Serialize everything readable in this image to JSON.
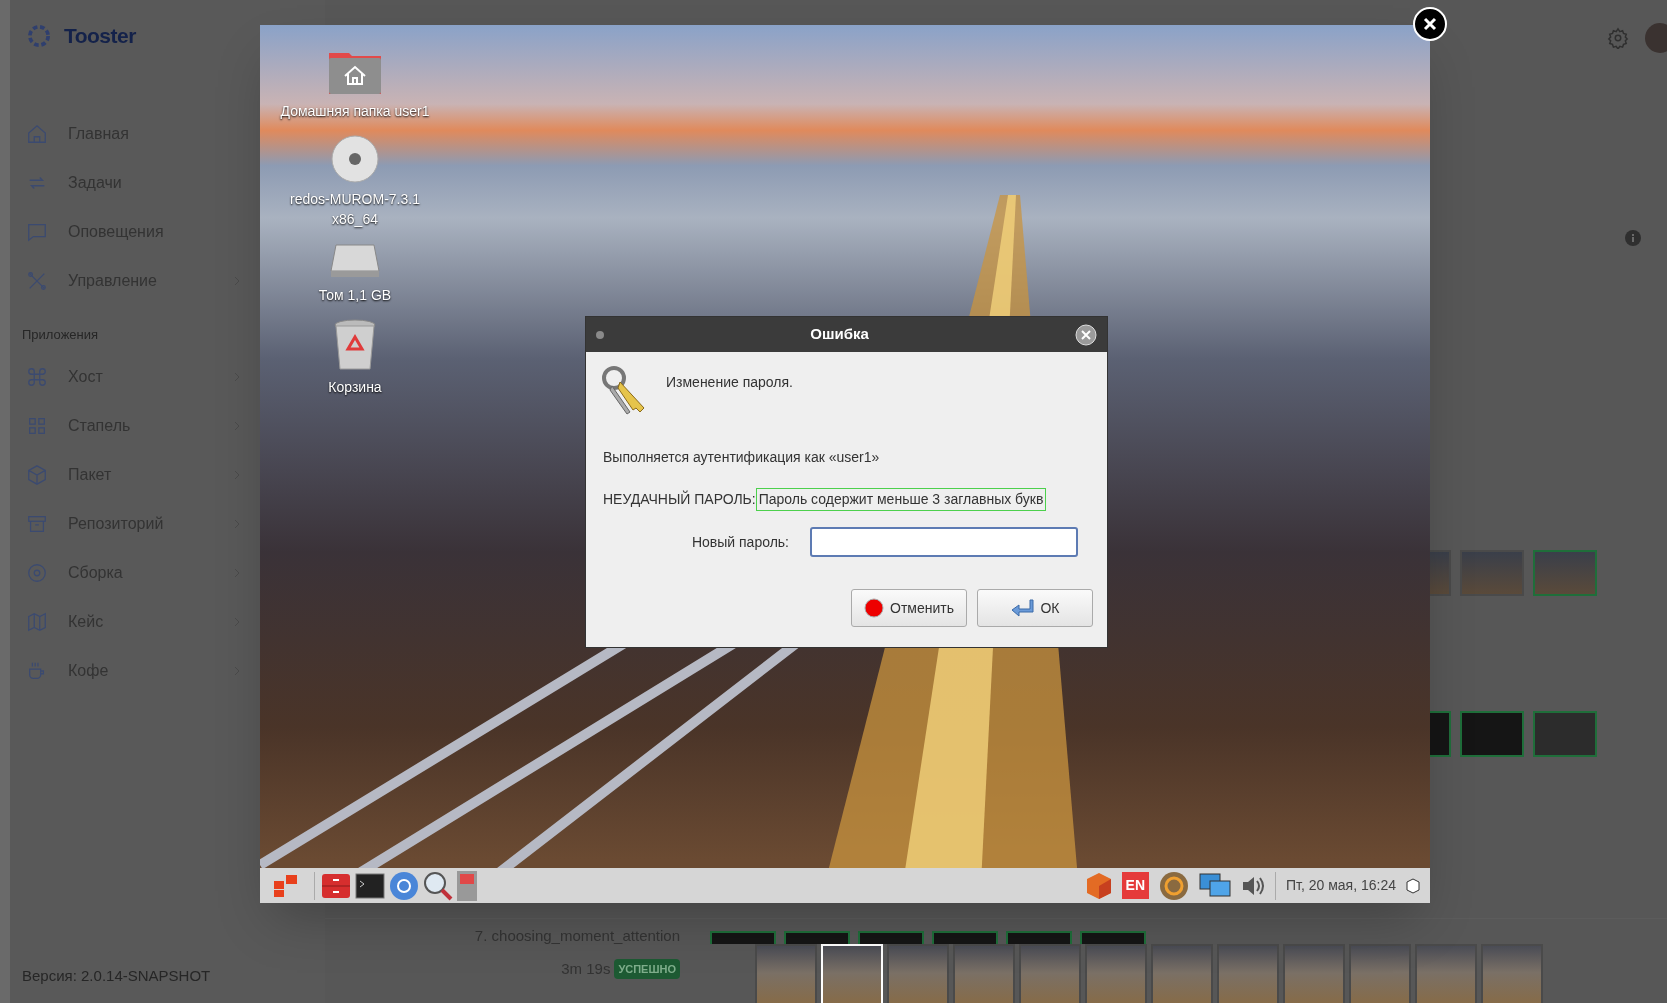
{
  "app": {
    "logo_text": "Tooster",
    "nav": [
      {
        "label": "Главная",
        "submenu": false
      },
      {
        "label": "Задачи",
        "submenu": false
      },
      {
        "label": "Оповещения",
        "submenu": false
      },
      {
        "label": "Управление",
        "submenu": true
      }
    ],
    "section_label": "Приложения",
    "apps": [
      {
        "label": "Хост",
        "submenu": true
      },
      {
        "label": "Стапель",
        "submenu": true
      },
      {
        "label": "Пакет",
        "submenu": true
      },
      {
        "label": "Репозиторий",
        "submenu": true
      },
      {
        "label": "Сборка",
        "submenu": true
      },
      {
        "label": "Кейс",
        "submenu": true
      },
      {
        "label": "Кофе",
        "submenu": true
      }
    ],
    "version": "Версия: 2.0.14-SNAPSHOT"
  },
  "side_thumbnails": [
    {
      "kind": "desktop",
      "highlighted": false
    },
    {
      "kind": "desktop",
      "highlighted": false
    },
    {
      "kind": "desktop",
      "highlighted": true
    }
  ],
  "side_thumbnails_2": [
    {
      "kind": "terminal",
      "highlighted": true
    },
    {
      "kind": "terminal",
      "highlighted": true
    },
    {
      "kind": "blank",
      "highlighted": true
    }
  ],
  "step": {
    "name": "7. choosing_moment_attention",
    "duration": "3m 19s",
    "status": "УСПЕШНО",
    "back_thumbnails": [
      {
        "highlighted": true
      },
      {
        "highlighted": true
      },
      {
        "highlighted": true
      },
      {
        "highlighted": true
      },
      {
        "highlighted": true
      },
      {
        "highlighted": true
      }
    ],
    "thumbnails": [
      {
        "selected": false
      },
      {
        "selected": true
      },
      {
        "selected": false
      },
      {
        "selected": false
      },
      {
        "selected": false
      },
      {
        "selected": false
      },
      {
        "selected": false
      },
      {
        "selected": false
      },
      {
        "selected": false
      },
      {
        "selected": false
      },
      {
        "selected": false
      },
      {
        "selected": false
      }
    ]
  },
  "viewer": {
    "desktop_icons": [
      {
        "kind": "home",
        "label": "Домашняя папка user1"
      },
      {
        "kind": "disc",
        "label": "redos-MUROM-7.3.1 x86_64"
      },
      {
        "kind": "drive",
        "label": "Том 1,1 GB"
      },
      {
        "kind": "trash",
        "label": "Корзина"
      }
    ],
    "dialog": {
      "title": "Ошибка",
      "heading": "Изменение пароля.",
      "auth_text": "Выполняется аутентификация как «user1»",
      "error_label": "НЕУДАЧНЫЙ ПАРОЛЬ:",
      "error_message": "Пароль содержит меньше 3 заглавных букв",
      "field_label": "Новый пароль:",
      "buttons": [
        {
          "kind": "cancel",
          "label": "Отменить"
        },
        {
          "kind": "ok",
          "label": "ОК"
        }
      ]
    },
    "taskbar": {
      "language": "EN",
      "clock": "Пт, 20 мая, 16:24"
    }
  }
}
